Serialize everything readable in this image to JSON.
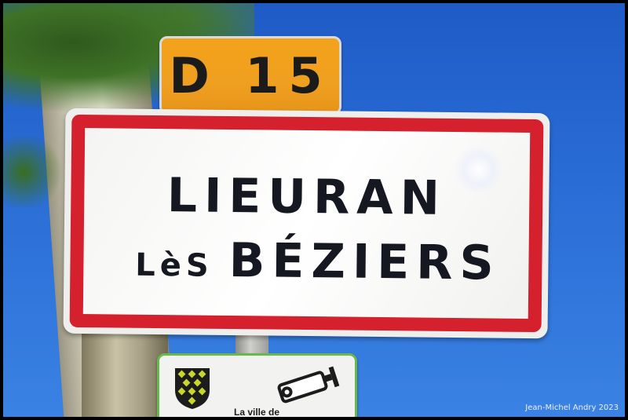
{
  "route_sign": {
    "label": "D 15"
  },
  "town_sign": {
    "line1": "LIEURAN",
    "prefix": "LèS",
    "name": "BÉZIERS"
  },
  "info_sign": {
    "text": "La ville de",
    "icons": [
      "crest-icon",
      "cctv-camera-icon"
    ]
  },
  "credit": "Jean-Michel Andry 2023",
  "colors": {
    "sign_border": "#d5212e",
    "route_plate": "#f3a21b",
    "sky": "#2a6dd6",
    "info_border": "#66b94a"
  }
}
